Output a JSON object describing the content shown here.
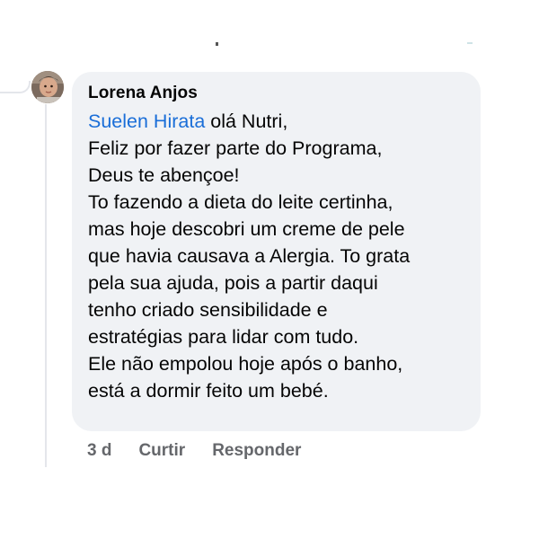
{
  "comment": {
    "author": "Lorena Anjos",
    "mention": "Suelen Hirata",
    "first_line_rest": " olá Nutri,",
    "lines": [
      "Feliz por fazer parte do Programa,",
      "Deus te abençoe!",
      "To fazendo a dieta do leite certinha,",
      "mas hoje descobri um creme de pele",
      "que havia causava a Alergia. To grata",
      "pela sua ajuda, pois a partir daqui",
      "tenho criado sensibilidade e",
      "estratégias para lidar com tudo.",
      "Ele não empolou hoje após o banho,",
      "está a dormir feito um bebé."
    ],
    "timestamp": "3 d",
    "like_label": "Curtir",
    "reply_label": "Responder"
  },
  "colors": {
    "bubble": "#f0f2f5",
    "text": "#050505",
    "mention": "#1a6ed8",
    "meta": "#65676b"
  }
}
